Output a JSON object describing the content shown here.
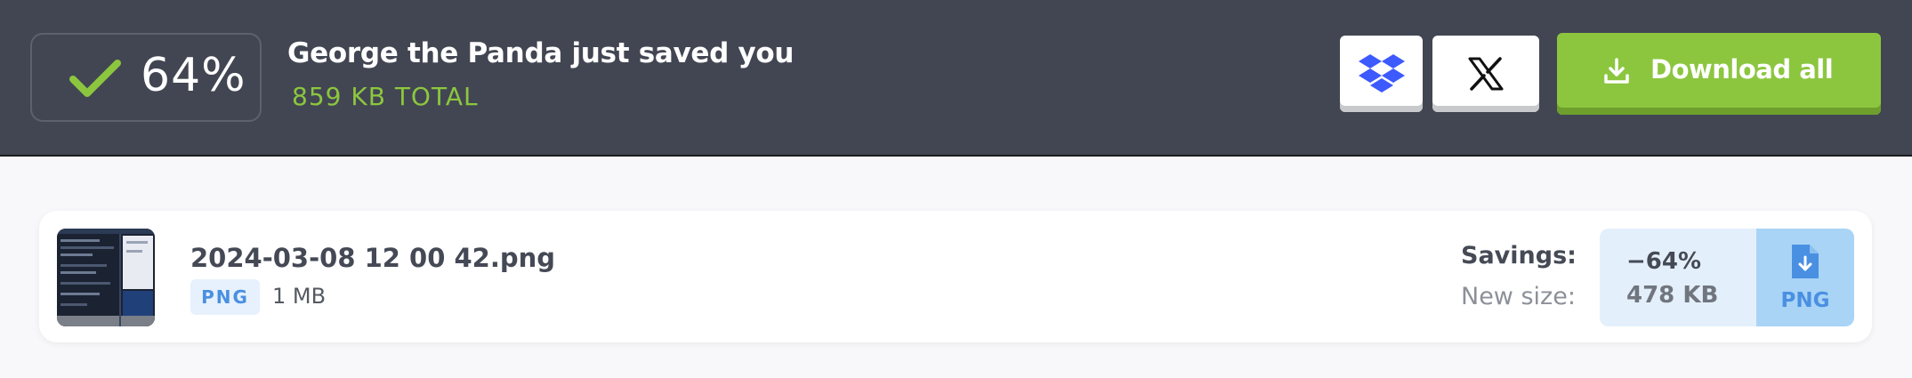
{
  "header": {
    "savings_percent": "64%",
    "headline": "George the Panda just saved you",
    "total": "859 KB TOTAL",
    "download_all_label": "Download all",
    "share": {
      "dropbox_icon": "dropbox-icon",
      "x_icon": "x-icon"
    }
  },
  "file": {
    "name": "2024-03-08 12 00 42.png",
    "type": "PNG",
    "original_size": "1 MB",
    "savings_label": "Savings:",
    "new_size_label": "New size:",
    "savings_value": "−64%",
    "new_size_value": "478 KB",
    "download_type": "PNG"
  },
  "colors": {
    "topbar_bg": "#424652",
    "accent_green": "#8cc63f",
    "accent_blue": "#4a90e2",
    "dropbox_blue": "#3d5afe"
  }
}
